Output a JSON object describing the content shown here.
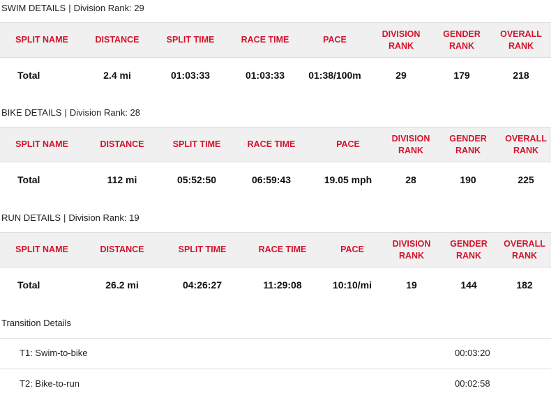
{
  "columns": [
    "SPLIT NAME",
    "DISTANCE",
    "SPLIT TIME",
    "RACE TIME",
    "PACE",
    [
      "DIVISION",
      "RANK"
    ],
    [
      "GENDER",
      "RANK"
    ],
    [
      "OVERALL",
      "RANK"
    ]
  ],
  "swim": {
    "title": "SWIM DETAILS",
    "rank_label": "Division Rank: 29",
    "row": {
      "name": "Total",
      "distance": "2.4 mi",
      "split_time": "01:03:33",
      "race_time": "01:03:33",
      "pace": "01:38/100m",
      "division_rank": "29",
      "gender_rank": "179",
      "overall_rank": "218"
    }
  },
  "bike": {
    "title": "BIKE DETAILS",
    "rank_label": "Division Rank: 28",
    "row": {
      "name": "Total",
      "distance": "112 mi",
      "split_time": "05:52:50",
      "race_time": "06:59:43",
      "pace": "19.05 mph",
      "division_rank": "28",
      "gender_rank": "190",
      "overall_rank": "225"
    }
  },
  "run": {
    "title": "RUN DETAILS",
    "rank_label": "Division Rank: 19",
    "row": {
      "name": "Total",
      "distance": "26.2 mi",
      "split_time": "04:26:27",
      "race_time": "11:29:08",
      "pace": "10:10/mi",
      "division_rank": "19",
      "gender_rank": "144",
      "overall_rank": "182"
    }
  },
  "transitions": {
    "title": "Transition Details",
    "items": [
      {
        "label": "T1: Swim-to-bike",
        "time": "00:03:20"
      },
      {
        "label": "T2: Bike-to-run",
        "time": "00:02:58"
      }
    ]
  },
  "colors": {
    "header_text": "#d2142d",
    "header_bg": "#f0f0f0",
    "border": "#dcdcdc"
  }
}
